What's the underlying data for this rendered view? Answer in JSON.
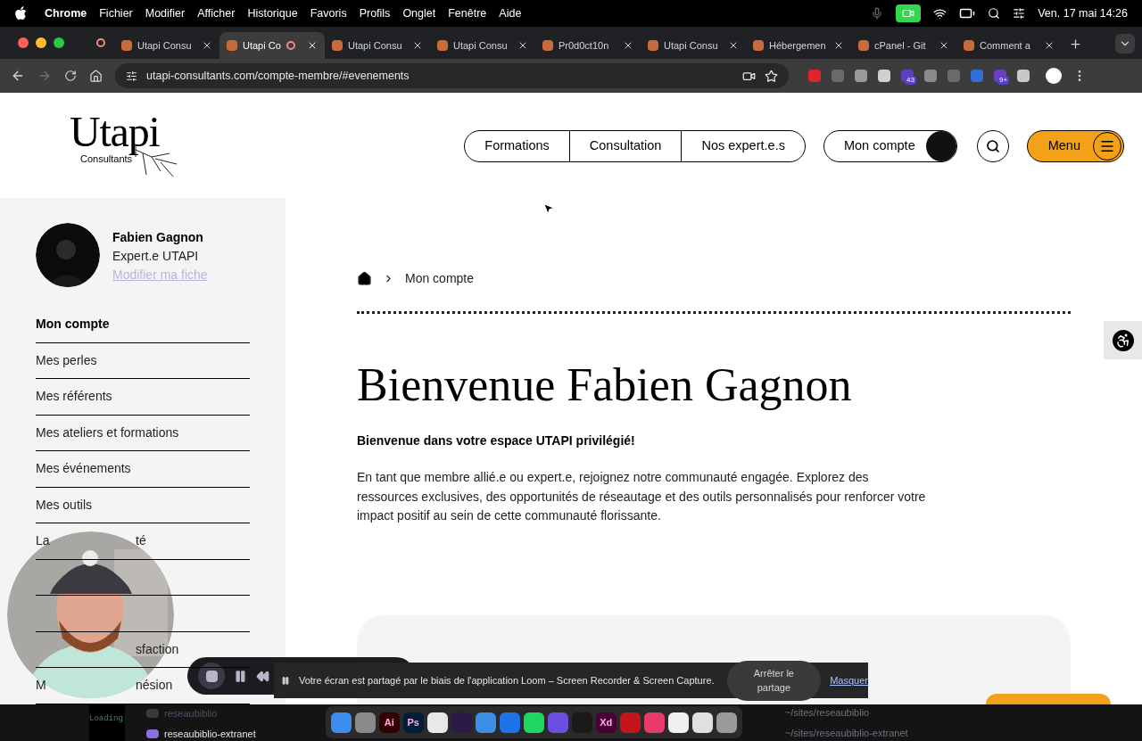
{
  "menubar": {
    "app": "Chrome",
    "menus": [
      "Fichier",
      "Modifier",
      "Afficher",
      "Historique",
      "Favoris",
      "Profils",
      "Onglet",
      "Fenêtre",
      "Aide"
    ],
    "clock": "Ven. 17 mai 14:26"
  },
  "tabs": [
    {
      "title": "Utapi Consu",
      "selected": false,
      "recording": false
    },
    {
      "title": "Utapi Co",
      "selected": true,
      "recording": true
    },
    {
      "title": "Utapi Consu",
      "selected": false,
      "recording": false
    },
    {
      "title": "Utapi Consu",
      "selected": false,
      "recording": false
    },
    {
      "title": "Pr0d0ct10n",
      "selected": false,
      "recording": false
    },
    {
      "title": "Utapi Consu",
      "selected": false,
      "recording": false
    },
    {
      "title": "Hébergemen",
      "selected": false,
      "recording": false
    },
    {
      "title": "cPanel - Git",
      "selected": false,
      "recording": false
    },
    {
      "title": "Comment a",
      "selected": false,
      "recording": false
    }
  ],
  "address": "utapi-consultants.com/compte-membre/#evenements",
  "extensions": [
    {
      "color": "#e0242b"
    },
    {
      "color": "#6b6b6b"
    },
    {
      "color": "#9a9a9a"
    },
    {
      "color": "#d0d0d0"
    },
    {
      "color": "#5b3fc4",
      "badge": "43"
    },
    {
      "color": "#8a8a8a"
    },
    {
      "color": "#6b6b6b"
    },
    {
      "color": "#2f6fd6"
    },
    {
      "color": "#6a3fc4",
      "badge": "9+"
    },
    {
      "color": "#c8c8c8"
    }
  ],
  "header": {
    "logo": {
      "name": "Utapi",
      "tagline": "Consultants"
    },
    "nav": [
      "Formations",
      "Consultation",
      "Nos expert.e.s"
    ],
    "account": "Mon compte",
    "menu": "Menu"
  },
  "profile": {
    "name": "Fabien Gagnon",
    "role": "Expert.e UTAPI",
    "edit_link": "Modifier ma fiche"
  },
  "sidebar": {
    "items": [
      {
        "label": "Mon compte",
        "selected": true
      },
      {
        "label": "Mes perles",
        "selected": false
      },
      {
        "label": "Mes référents",
        "selected": false
      },
      {
        "label": "Mes ateliers et formations",
        "selected": false
      },
      {
        "label": "Mes événements",
        "selected": false
      },
      {
        "label": "Mes outils",
        "selected": false
      }
    ],
    "covered_items": [
      {
        "kind": "partial",
        "left": "La",
        "right": "té"
      },
      {
        "kind": "blank"
      },
      {
        "kind": "blank"
      },
      {
        "kind": "partial",
        "right": "sfaction"
      },
      {
        "kind": "partial",
        "left": "M",
        "right": "nésion"
      }
    ]
  },
  "breadcrumb": [
    "Mon compte"
  ],
  "title": "Bienvenue Fabien Gagnon",
  "subtitle": "Bienvenue dans votre espace UTAPI privilégié!",
  "intro": "En tant que membre allié.e ou expert.e, rejoignez notre communauté engagée. Explorez des ressources exclusives, des opportunités de réseautage et des outils personnalisés pour renforcer votre impact positif au sein de cette communauté florissante.",
  "share_bar": {
    "message": "Votre écran est partagé par le biais de l'application Loom – Screen Recorder & Screen Capture.",
    "stop": "Arrêter le partage",
    "hide": "Masquer"
  },
  "desktop": {
    "terminal": "Loading",
    "folders": [
      "reseaubiblio",
      "reseaubiblio-extranet"
    ],
    "paths": [
      "~/sites/reseaubiblio",
      "~/sites/reseaubiblio-extranet"
    ]
  },
  "dock": [
    {
      "color": "#3b8ef0"
    },
    {
      "color": "#8a8a8a"
    },
    {
      "color": "#330000",
      "label": "Ai"
    },
    {
      "color": "#001e36",
      "label": "Ps"
    },
    {
      "color": "#e8e8e8"
    },
    {
      "color": "#2a1a4a"
    },
    {
      "color": "#3a8ee6"
    },
    {
      "color": "#1e73e8"
    },
    {
      "color": "#1ed760"
    },
    {
      "color": "#6b4fe0"
    },
    {
      "color": "#1a1a1a"
    },
    {
      "color": "#470137",
      "label": "Xd"
    },
    {
      "color": "#c4151c"
    },
    {
      "color": "#e83a6a"
    },
    {
      "color": "#f0f0f0"
    },
    {
      "color": "#e0e0e0"
    },
    {
      "color": "#9a9a9a"
    }
  ]
}
